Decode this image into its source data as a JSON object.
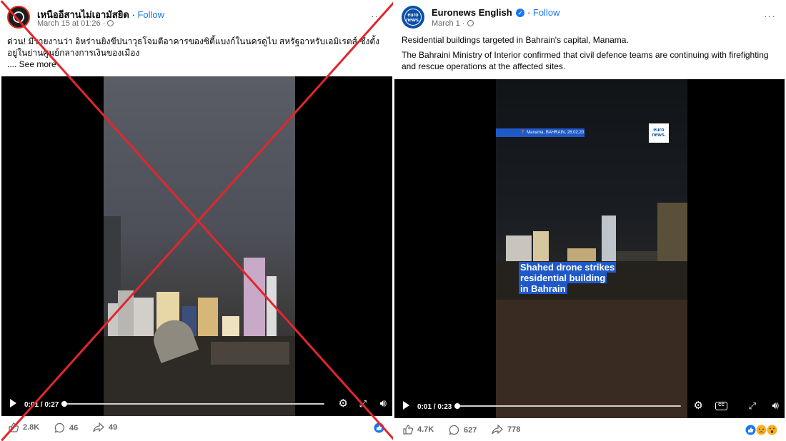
{
  "left_post": {
    "page_name": "เหนืออีสานไม่เอามัสยิด",
    "follow": "Follow",
    "meta": "March 15 at 01:26 ·",
    "caption": "ด่วน! มีรายงานว่า อิหร่านยิงขีปนาวุธโจมตีอาคารของซิตี้แบงก์ในนครดูไบ สหรัฐอาหรับเอมิเรตส์ ซึ่งตั้งอยู่ในย่านศูนย์กลางการเงินของเมือง",
    "see_more": ".... See more",
    "video": {
      "time": "0:01 / 0:27",
      "progress": 0.0
    },
    "stats": {
      "likes": "2.8K",
      "comments": "46",
      "shares": "49"
    },
    "crossed_out": true,
    "cross_color": "#e2262e"
  },
  "right_post": {
    "page_name": "Euronews English",
    "follow": "Follow",
    "meta": "March 1 ·",
    "caption_line1": "Residential buildings targeted in Bahrain's capital, Manama.",
    "caption_line2": "The Bahraini Ministry of Interior confirmed that civil defence teams are continuing with firefighting and rescue operations at the affected sites.",
    "video": {
      "time": "0:01 / 0:23",
      "progress": 0.0,
      "dateline": "📍 Manama, BAHRAIN, 28.02.2026",
      "bug": "euro news.",
      "headline_1": "Shahed drone strikes",
      "headline_2": "residential building",
      "headline_3": "in Bahrain"
    },
    "stats": {
      "likes": "4.7K",
      "comments": "627",
      "shares": "778"
    }
  },
  "colors": {
    "accent": "#1877f2",
    "brand": "#0b4fa8",
    "cross": "#e2262e"
  }
}
